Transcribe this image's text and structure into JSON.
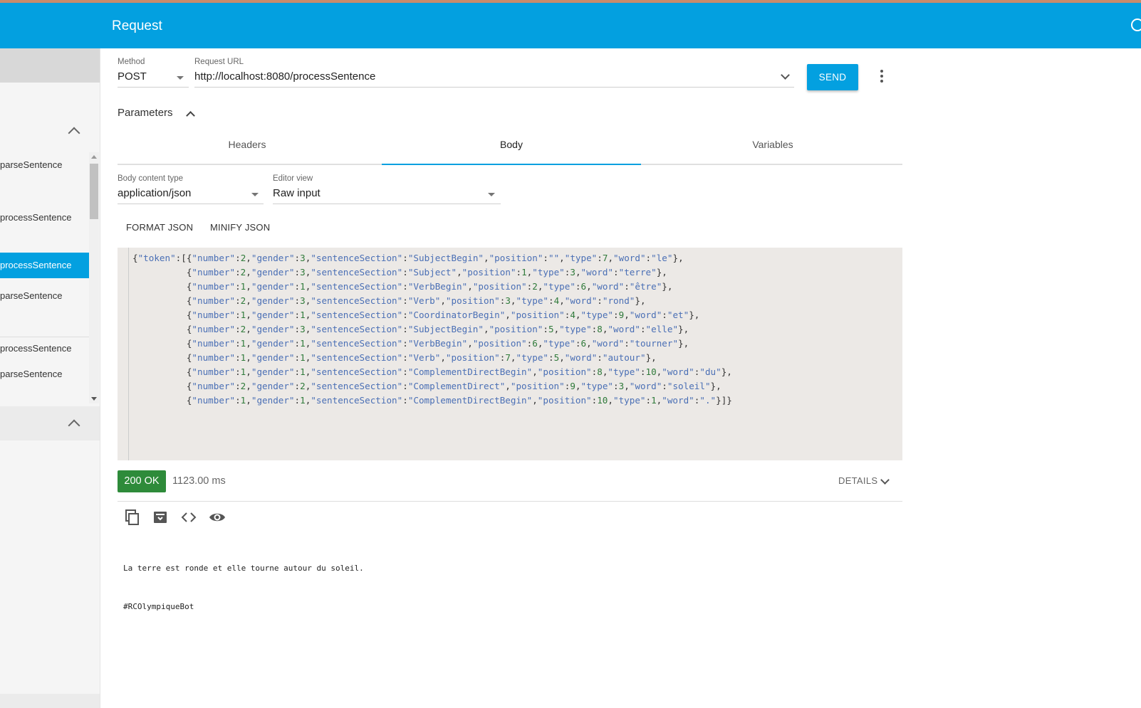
{
  "appbar": {
    "title": "Request"
  },
  "sidebar": {
    "items": [
      {
        "label": "parseSentence",
        "active": false
      },
      {
        "label": "processSentence",
        "active": false
      },
      {
        "label": "processSentence",
        "active": true
      },
      {
        "label": "parseSentence",
        "active": false
      },
      {
        "label": "processSentence",
        "active": false
      },
      {
        "label": "parseSentence",
        "active": false
      }
    ]
  },
  "request": {
    "method_label": "Method",
    "method_value": "POST",
    "url_label": "Request URL",
    "url_value": "http://localhost:8080/processSentence",
    "send_label": "SEND",
    "parameters_label": "Parameters"
  },
  "tabs": [
    {
      "label": "Headers",
      "active": false
    },
    {
      "label": "Body",
      "active": true
    },
    {
      "label": "Variables",
      "active": false
    }
  ],
  "body": {
    "content_type_label": "Body content type",
    "content_type_value": "application/json",
    "editor_view_label": "Editor view",
    "editor_view_value": "Raw input",
    "format_json_label": "FORMAT JSON",
    "minify_json_label": "MINIFY JSON",
    "editor_lines": [
      "{\"token\":[{\"number\":2,\"gender\":3,\"sentenceSection\":\"SubjectBegin\",\"position\":\"\",\"type\":7,\"word\":\"le\"},",
      "          {\"number\":2,\"gender\":3,\"sentenceSection\":\"Subject\",\"position\":1,\"type\":3,\"word\":\"terre\"},",
      "          {\"number\":1,\"gender\":1,\"sentenceSection\":\"VerbBegin\",\"position\":2,\"type\":6,\"word\":\"être\"},",
      "          {\"number\":2,\"gender\":3,\"sentenceSection\":\"Verb\",\"position\":3,\"type\":4,\"word\":\"rond\"},",
      "          {\"number\":1,\"gender\":1,\"sentenceSection\":\"CoordinatorBegin\",\"position\":4,\"type\":9,\"word\":\"et\"},",
      "          {\"number\":2,\"gender\":3,\"sentenceSection\":\"SubjectBegin\",\"position\":5,\"type\":8,\"word\":\"elle\"},",
      "          {\"number\":1,\"gender\":1,\"sentenceSection\":\"VerbBegin\",\"position\":6,\"type\":6,\"word\":\"tourner\"},",
      "          {\"number\":1,\"gender\":1,\"sentenceSection\":\"Verb\",\"position\":7,\"type\":5,\"word\":\"autour\"},",
      "          {\"number\":1,\"gender\":1,\"sentenceSection\":\"ComplementDirectBegin\",\"position\":8,\"type\":10,\"word\":\"du\"},",
      "          {\"number\":2,\"gender\":2,\"sentenceSection\":\"ComplementDirect\",\"position\":9,\"type\":3,\"word\":\"soleil\"},",
      "          {\"number\":1,\"gender\":1,\"sentenceSection\":\"ComplementDirectBegin\",\"position\":10,\"type\":1,\"word\":\".\"}]}"
    ]
  },
  "response": {
    "status": "200 OK",
    "status_color": "#2e8b3a",
    "time": "1123.00 ms",
    "details_label": "DETAILS",
    "icons": [
      "copy-icon",
      "save-icon",
      "code-icon",
      "eye-icon"
    ],
    "body_lines": [
      "La terre est ronde et elle tourne autour du soleil.",
      "#RCOlympiqueBot"
    ]
  },
  "colors": {
    "accent": "#03a0e0",
    "top_strip": "#c98b6b"
  }
}
